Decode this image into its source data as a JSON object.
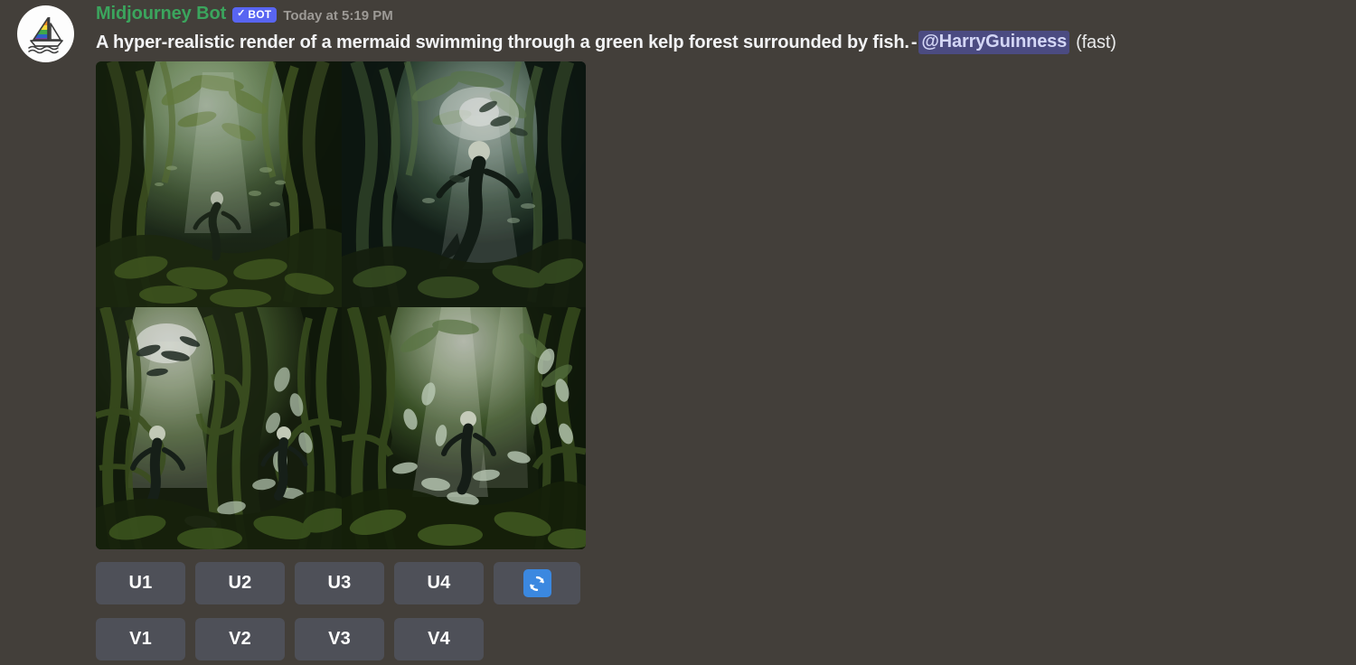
{
  "app": "discord-midjourney",
  "colors": {
    "background": "#433f3a",
    "author_green": "#3ba55d",
    "bot_badge_blurple": "#5865f2",
    "mention_bg": "#4b4b81",
    "mention_text": "#d3d6f5",
    "button_bg": "#4e5058",
    "reroll_blue": "#3b88e0",
    "body_text": "#f2f3f5",
    "timestamp_text": "#9d9a96"
  },
  "message": {
    "avatar_icon": "sailboat-rainbow-icon",
    "author": "Midjourney Bot",
    "bot_badge": {
      "check": "✓",
      "label": "BOT"
    },
    "timestamp": "Today at 5:19 PM",
    "prompt": "A hyper-realistic render of a mermaid swimming through a green kelp forest surrounded by fish.",
    "separator": "-",
    "mention": "@HarryGuinness",
    "mode": "(fast)"
  },
  "image_grid": {
    "count": 4,
    "cells": [
      {
        "index": 1,
        "alt": "Kelp forest tunnel with a lone swimmer, sunlight above",
        "palette": [
          "#0d1408",
          "#25330f",
          "#4a6227",
          "#8aa85c",
          "#c9dfd2",
          "#1b2a22"
        ]
      },
      {
        "index": 2,
        "alt": "Mermaid silhouette swimming upward toward light through kelp",
        "palette": [
          "#0a1310",
          "#1e3026",
          "#3e5a3a",
          "#7f9d7a",
          "#d4e6e2",
          "#17231c"
        ]
      },
      {
        "index": 3,
        "alt": "Two figures and fish in a bright kelp forest clearing",
        "palette": [
          "#101a0c",
          "#2a3d16",
          "#55702c",
          "#9bb870",
          "#dfeee4",
          "#1d2b1c"
        ]
      },
      {
        "index": 4,
        "alt": "Swimmer among schooling fish in sunlit kelp corridor",
        "palette": [
          "#0c150a",
          "#243314",
          "#4e6a2a",
          "#93ac68",
          "#e2efe6",
          "#1a2718"
        ]
      }
    ]
  },
  "buttons": {
    "upscale_row": [
      {
        "label": "U1",
        "name": "upscale-1"
      },
      {
        "label": "U2",
        "name": "upscale-2"
      },
      {
        "label": "U3",
        "name": "upscale-3"
      },
      {
        "label": "U4",
        "name": "upscale-4"
      }
    ],
    "reroll": {
      "icon": "refresh-icon",
      "label": ""
    },
    "variation_row": [
      {
        "label": "V1",
        "name": "variation-1"
      },
      {
        "label": "V2",
        "name": "variation-2"
      },
      {
        "label": "V3",
        "name": "variation-3"
      },
      {
        "label": "V4",
        "name": "variation-4"
      }
    ]
  }
}
